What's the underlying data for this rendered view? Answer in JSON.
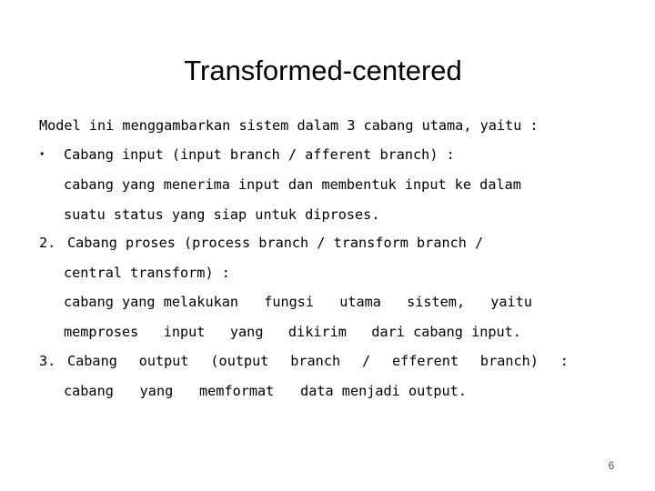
{
  "slide": {
    "title": "Transformed-centered",
    "intro": "Model ini menggambarkan sistem dalam 3 cabang utama, yaitu :",
    "items": [
      {
        "marker": "•",
        "heading": "Cabang input (input branch / afferent branch) :",
        "description_lines": [
          "cabang yang menerima input dan membentuk input ke dalam",
          "suatu status yang siap untuk diproses."
        ]
      },
      {
        "marker": "2.",
        "heading_lines": [
          "Cabang proses (process branch / transform branch /",
          "central transform) :"
        ],
        "description_words": [
          [
            "cabang yang melakukan",
            "fungsi",
            "utama",
            "sistem,",
            "yaitu"
          ],
          [
            "memproses",
            "input",
            "yang",
            "dikirim",
            "dari cabang input."
          ]
        ]
      },
      {
        "marker": "3.",
        "heading_words": [
          "Cabang",
          "output",
          "(output",
          "branch",
          "/",
          "efferent",
          "branch)",
          ":"
        ],
        "description_words": [
          "cabang",
          "yang",
          "memformat",
          "data menjadi output."
        ]
      }
    ],
    "page_number": "6"
  }
}
